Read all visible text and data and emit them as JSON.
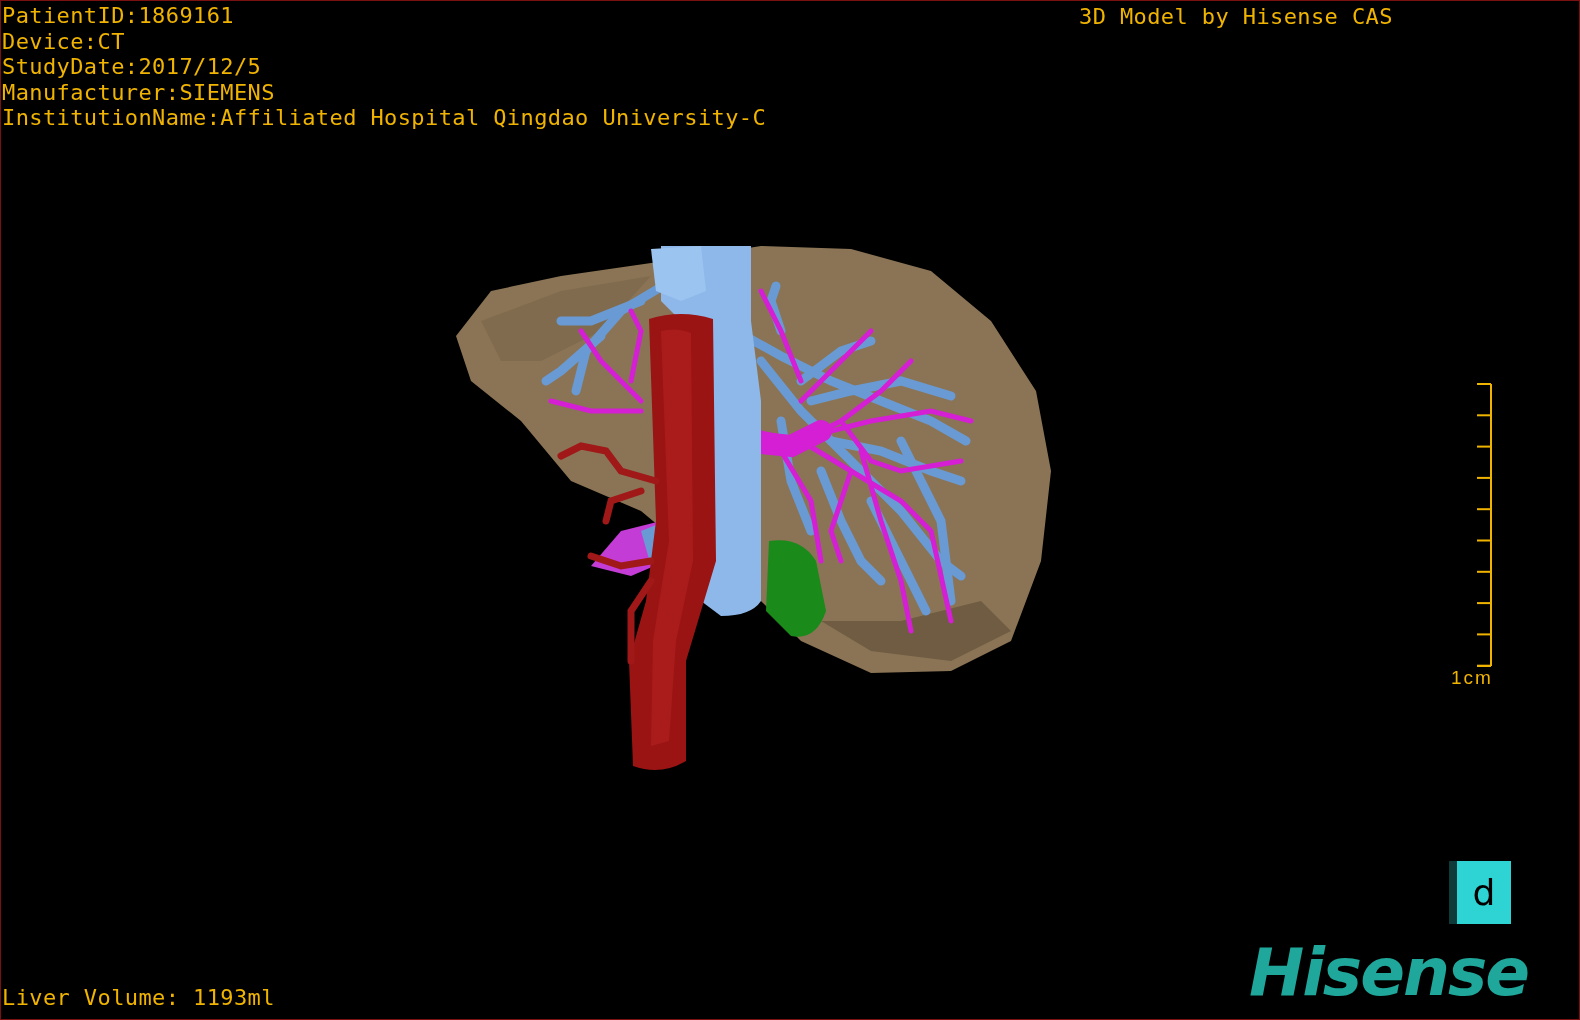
{
  "info_lines": [
    "PatientID:1869161",
    "Device:CT",
    "StudyDate:2017/12/5",
    "Manufacturer:SIEMENS",
    "InstitutionName:Affiliated Hospital Qingdao University-C"
  ],
  "model_caption": "3D Model by Hisense CAS",
  "scale_bar": {
    "label": "1cm"
  },
  "liver_volume": "Liver Volume: 1193ml",
  "view_button": {
    "label": "d"
  },
  "logo": "Hisense"
}
